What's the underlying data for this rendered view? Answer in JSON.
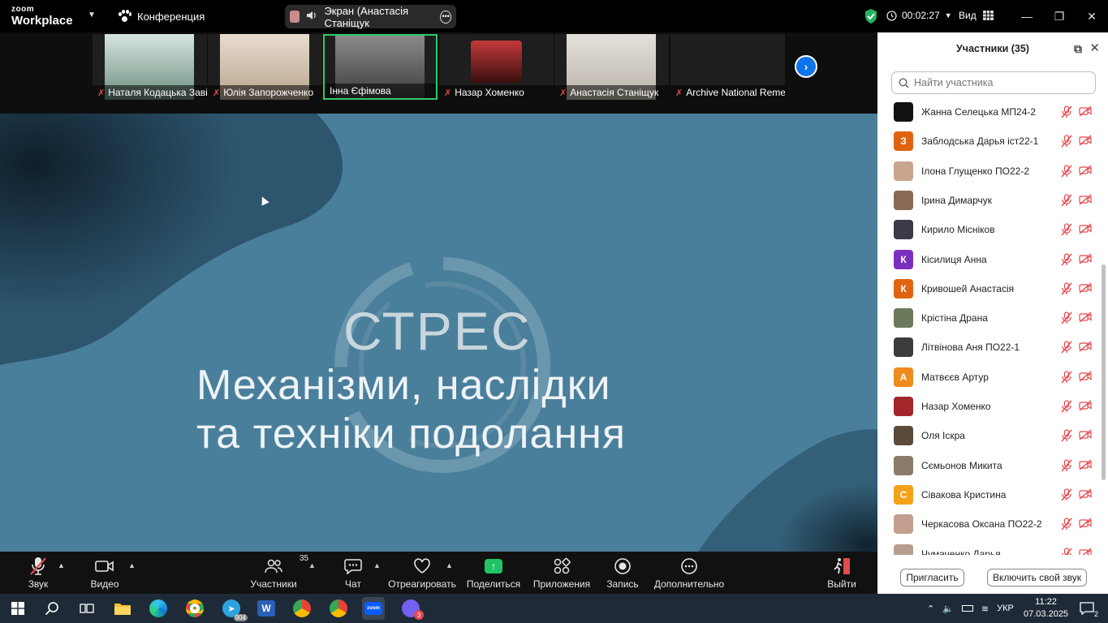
{
  "titlebar": {
    "logo_top": "zoom",
    "logo_bottom": "Workplace",
    "meeting_label": "Конференция",
    "screen_share_label": "Экран (Анастасія Станіщук",
    "timer": "00:02:27",
    "view_label": "Вид"
  },
  "thumbnails": [
    {
      "name": "Наталя Кодацька Заві...",
      "color": "#6d8f7f"
    },
    {
      "name": "Юлія Запорожченко",
      "color": "#b7a48c"
    },
    {
      "name": "Інна Єфімова",
      "color": "#4c4c4c"
    },
    {
      "name": "Назар Хоменко",
      "color": "#7d1f20"
    },
    {
      "name": "Анастасія Станіщук",
      "color": "#b9b2a8"
    },
    {
      "name": "Archive National Reme...",
      "color": "#1e1e1e"
    }
  ],
  "slide": {
    "title": "СТРЕС",
    "line1": "Механізми, наслідки",
    "line2": "та техніки подолання"
  },
  "panel": {
    "title": "Участники (35)",
    "search_placeholder": "Найти участника",
    "participants": [
      {
        "name": "Жанна Селецька МП24-2",
        "initial": "",
        "color": "#111111"
      },
      {
        "name": "Заблодська Дарья іст22-1",
        "initial": "З",
        "color": "#e0640f"
      },
      {
        "name": "Ілона Глущенко ПО22-2",
        "initial": "",
        "color": "#c9a48e"
      },
      {
        "name": "Ірина Димарчук",
        "initial": "",
        "color": "#8a6a55"
      },
      {
        "name": "Кирило Місніков",
        "initial": "",
        "color": "#3a3a48"
      },
      {
        "name": "Кісилиця Анна",
        "initial": "К",
        "color": "#7b2fbe"
      },
      {
        "name": "Кривошей Анастасія",
        "initial": "К",
        "color": "#e0640f"
      },
      {
        "name": "Крістіна Драна",
        "initial": "",
        "color": "#6b7a5a"
      },
      {
        "name": "Літвінова Аня ПО22-1",
        "initial": "",
        "color": "#3c3c3c"
      },
      {
        "name": "Матвєєв Артур",
        "initial": "А",
        "color": "#f08a1c"
      },
      {
        "name": "Назар Хоменко",
        "initial": "",
        "color": "#a3262a"
      },
      {
        "name": "Оля Іскра",
        "initial": "",
        "color": "#5a4a3a"
      },
      {
        "name": "Сємьонов Микита",
        "initial": "",
        "color": "#8b7b6b"
      },
      {
        "name": "Сівакова Кристина",
        "initial": "С",
        "color": "#f3a21a"
      },
      {
        "name": "Черкасова Оксана ПО22-2",
        "initial": "",
        "color": "#c49e8e"
      },
      {
        "name": "Чумаченко Дарья",
        "initial": "",
        "color": "#b69d8d"
      }
    ],
    "invite_label": "Пригласить",
    "unmute_label": "Включить свой звук"
  },
  "toolbar": {
    "audio": "Звук",
    "video": "Видео",
    "participants": "Участники",
    "participants_count": "35",
    "chat": "Чат",
    "react": "Отреагировать",
    "share": "Поделиться",
    "apps": "Приложения",
    "record": "Запись",
    "more": "Дополнительно",
    "leave": "Выйти"
  },
  "taskbar": {
    "language": "УКР",
    "time": "11:22",
    "date": "07.03.2025",
    "telegram_badge": "904",
    "viber_badge": "3",
    "notif_count": "2"
  }
}
